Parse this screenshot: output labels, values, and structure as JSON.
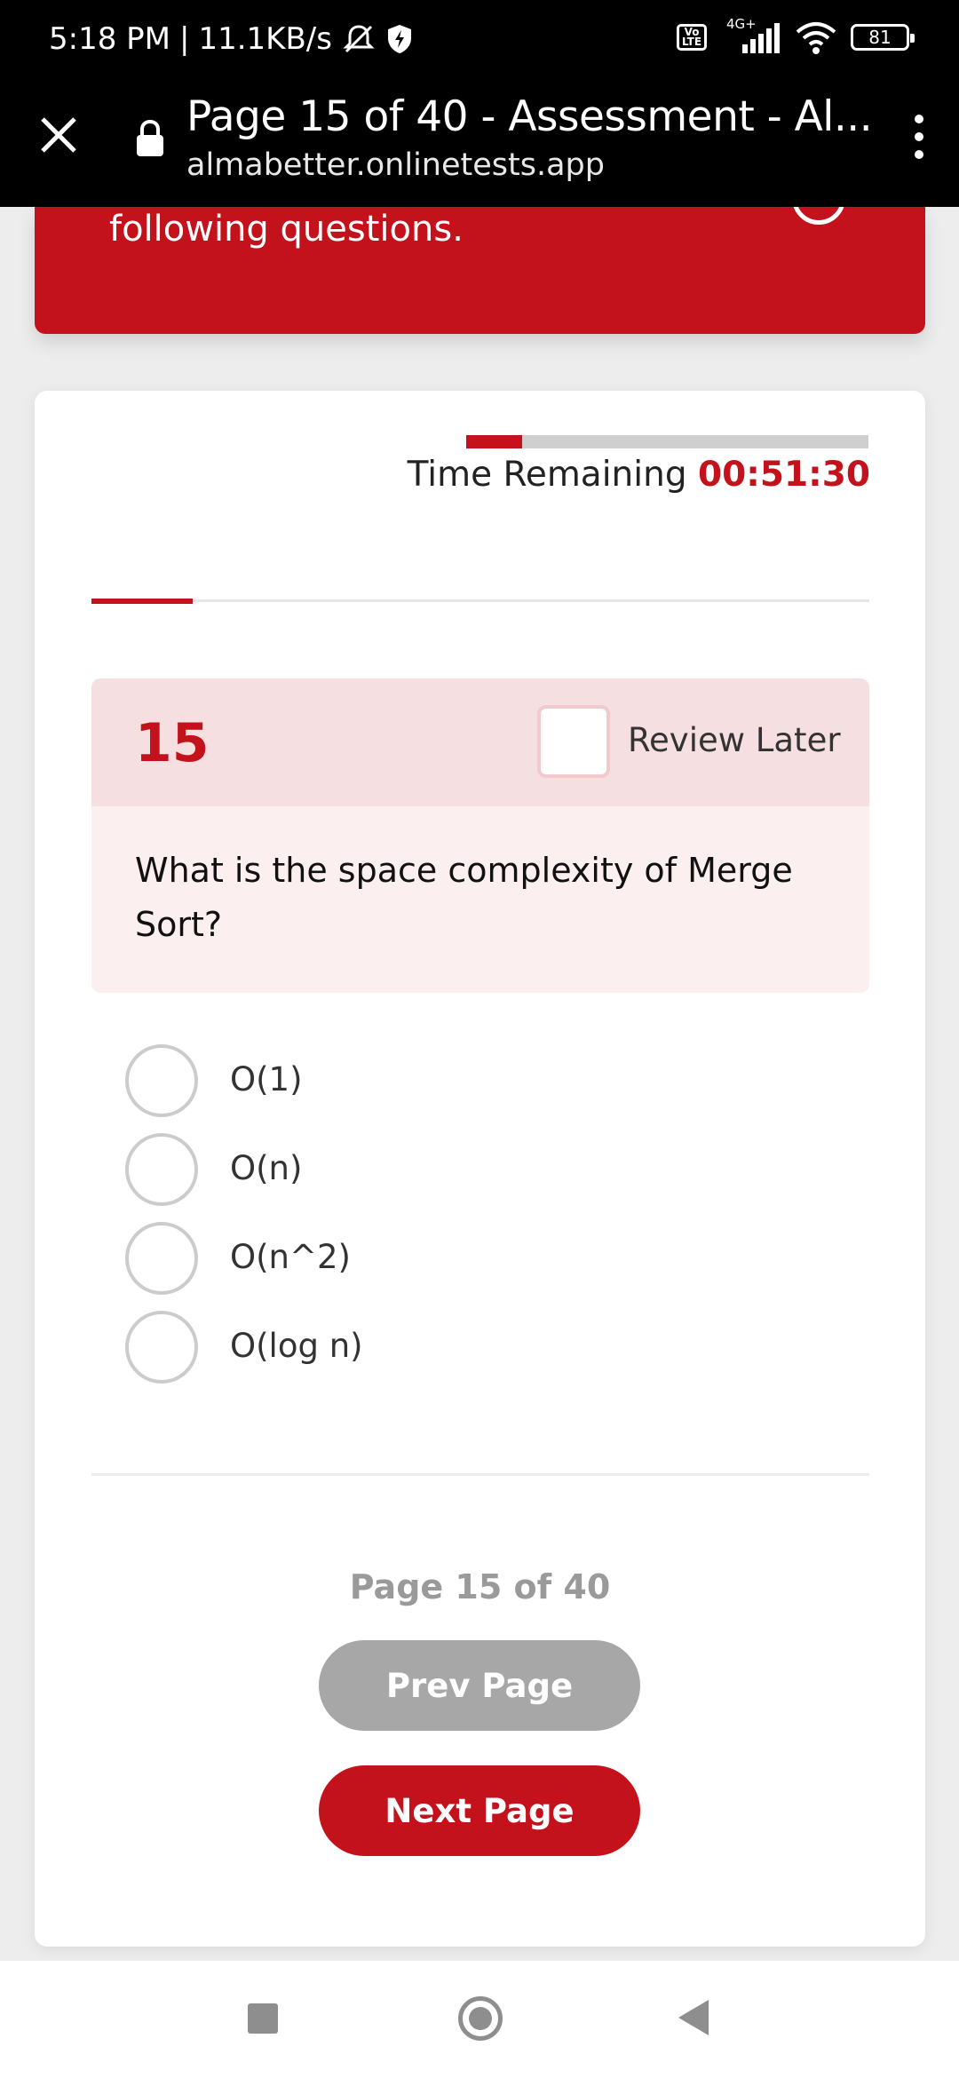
{
  "status_bar": {
    "time": "5:18 PM",
    "separator": "|",
    "speed": "11.1KB/s",
    "network": "4G+",
    "volte": "Vo LTE",
    "battery": "81"
  },
  "browser": {
    "page_title": "Page 15 of 40 - Assessment - Al...",
    "url": "almabetter.onlinetests.app"
  },
  "banner": {
    "text": "following questions."
  },
  "timer": {
    "label": "Time Remaining",
    "value": "00:51:30",
    "fraction_elapsed": 0.14
  },
  "progress": {
    "fraction": 0.13
  },
  "question": {
    "number": "15",
    "review_label": "Review Later",
    "text": "What is the space complexity of Merge Sort?",
    "options": [
      "O(1)",
      "O(n)",
      "O(n^2)",
      "O(log n)"
    ]
  },
  "pagination": {
    "indicator": "Page 15 of 40",
    "prev_label": "Prev Page",
    "next_label": "Next Page"
  },
  "colors": {
    "brand_red": "#c3121b",
    "disabled_gray": "#a7a7a7"
  }
}
